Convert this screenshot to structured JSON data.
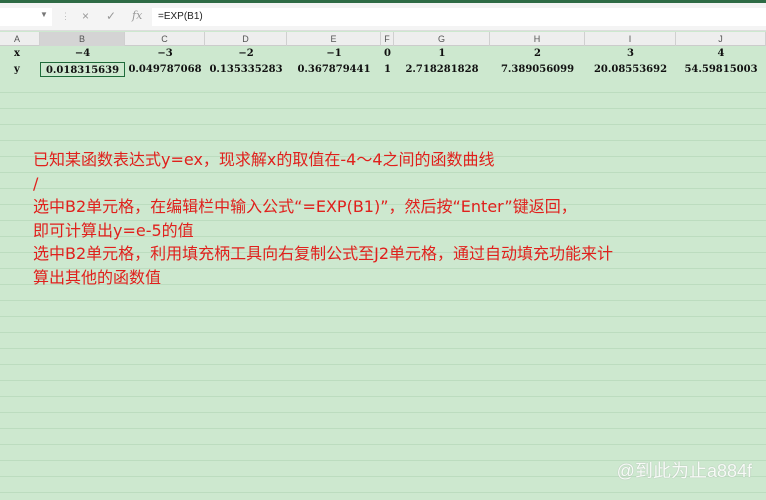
{
  "formula_bar": {
    "name_box": "",
    "cancel_icon": "×",
    "enter_icon": "✓",
    "fx_label": "fx",
    "formula": "=EXP(B1)"
  },
  "columns": [
    "A",
    "B",
    "C",
    "D",
    "E",
    "F",
    "G",
    "H",
    "I",
    "J"
  ],
  "rows": [
    [
      "x",
      "−4",
      "−3",
      "−2",
      "−1",
      "0",
      "1",
      "2",
      "3",
      "4"
    ],
    [
      "y",
      "0.018315639",
      "0.049787068",
      "0.135335283",
      "0.367879441",
      "1",
      "2.718281828",
      "7.389056099",
      "20.08553692",
      "54.59815003"
    ]
  ],
  "notes": [
    "已知某函数表达式y=ex，现求解x的取值在-4～4之间的函数曲线",
    "/",
    "选中B2单元格，在编辑栏中输入公式“=EXP(B1)”，然后按“Enter”键返回，",
    "即可计算出y=e-5的值",
    "选中B2单元格，利用填充柄工具向右复制公式至J2单元格，通过自动填充功能来计",
    "算出其他的函数值"
  ],
  "watermark": "@到此为止a884f"
}
